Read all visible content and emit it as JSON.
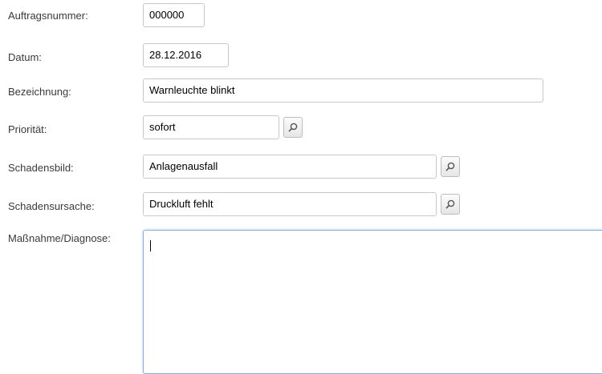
{
  "form": {
    "auftragsnummer": {
      "label": "Auftragsnummer:",
      "value": "000000"
    },
    "datum": {
      "label": "Datum:",
      "value": "28.12.2016"
    },
    "bezeichnung": {
      "label": "Bezeichnung:",
      "value": "Warnleuchte blinkt"
    },
    "prioritaet": {
      "label": "Priorität:",
      "value": "sofort"
    },
    "schadensbild": {
      "label": "Schadensbild:",
      "value": "Anlagenausfall"
    },
    "schadensursache": {
      "label": "Schadensursache:",
      "value": "Druckluft fehlt"
    },
    "massnahme": {
      "label": "Maßnahme/Diagnose:",
      "value": ""
    }
  },
  "icons": {
    "lookup": "search-icon"
  },
  "colors": {
    "focus_border": "#7fb4e6",
    "field_border": "#c9c9c9"
  }
}
